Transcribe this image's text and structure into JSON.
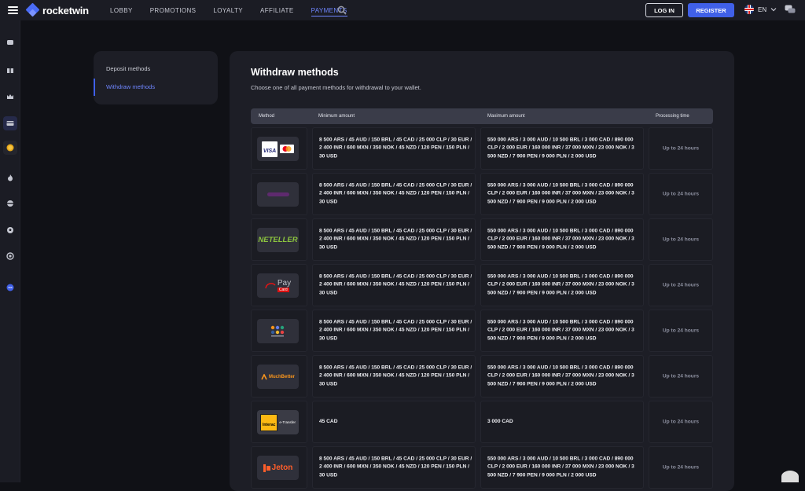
{
  "header": {
    "brand": "rocketwin",
    "nav": [
      {
        "label": "LOBBY",
        "active": false
      },
      {
        "label": "PROMOTIONS",
        "active": false
      },
      {
        "label": "LOYALTY",
        "active": false
      },
      {
        "label": "AFFILIATE",
        "active": false
      },
      {
        "label": "PAYMENTS",
        "active": true
      }
    ],
    "login_label": "LOG IN",
    "register_label": "REGISTER",
    "language": "EN"
  },
  "sidebar_icons": [
    "casino-icon",
    "gift-icon",
    "crown-icon",
    "card-icon",
    "coin-icon",
    "fire-icon",
    "tennis-icon",
    "soccer-icon",
    "settings-icon",
    "chat-icon"
  ],
  "side_menu": {
    "items": [
      {
        "label": "Deposit methods",
        "active": false
      },
      {
        "label": "Withdraw methods",
        "active": true
      }
    ]
  },
  "main": {
    "title": "Withdraw methods",
    "subtitle": "Choose one of all payment methods for withdrawal to your wallet.",
    "columns": [
      "Method",
      "Minimum amount",
      "Maximum amount",
      "Processing time"
    ],
    "rows": [
      {
        "method": "visa-mastercard",
        "logo_text": [
          "VISA"
        ],
        "min": "8 500 ARS / 45 AUD / 150 BRL / 45 CAD / 25 000 CLP / 30 EUR / 2 400 INR / 600 MXN / 350 NOK / 45 NZD / 120 PEN / 150 PLN / 30 USD",
        "max": "550 000 ARS / 3 000 AUD / 10 500 BRL / 3 000 CAD / 890 000 CLP / 2 000 EUR / 160 000 INR / 37 000 MXN / 23 000 NOK / 3 500 NZD / 7 900 PEN / 9 000 PLN / 2 000 USD",
        "time": "Up to 24 hours"
      },
      {
        "method": "skrill",
        "logo_text": [],
        "min": "8 500 ARS / 45 AUD / 150 BRL / 45 CAD / 25 000 CLP / 30 EUR / 2 400 INR / 600 MXN / 350 NOK / 45 NZD / 120 PEN / 150 PLN / 30 USD",
        "max": "550 000 ARS / 3 000 AUD / 10 500 BRL / 3 000 CAD / 890 000 CLP / 2 000 EUR / 160 000 INR / 37 000 MXN / 23 000 NOK / 3 500 NZD / 7 900 PEN / 9 000 PLN / 2 000 USD",
        "time": "Up to 24 hours"
      },
      {
        "method": "neteller",
        "logo_text": [
          "NETELLER"
        ],
        "min": "8 500 ARS / 45 AUD / 150 BRL / 45 CAD / 25 000 CLP / 30 EUR / 2 400 INR / 600 MXN / 350 NOK / 45 NZD / 120 PEN / 150 PLN / 30 USD",
        "max": "550 000 ARS / 3 000 AUD / 10 500 BRL / 3 000 CAD / 890 000 CLP / 2 000 EUR / 160 000 INR / 37 000 MXN / 23 000 NOK / 3 500 NZD / 7 900 PEN / 9 000 PLN / 2 000 USD",
        "time": "Up to 24 hours"
      },
      {
        "method": "paycard",
        "logo_text": [
          "Pay",
          "Card"
        ],
        "min": "8 500 ARS / 45 AUD / 150 BRL / 45 CAD / 25 000 CLP / 30 EUR / 2 400 INR / 600 MXN / 350 NOK / 45 NZD / 120 PEN / 150 PLN / 30 USD",
        "max": "550 000 ARS / 3 000 AUD / 10 500 BRL / 3 000 CAD / 890 000 CLP / 2 000 EUR / 160 000 INR / 37 000 MXN / 23 000 NOK / 3 500 NZD / 7 900 PEN / 9 000 PLN / 2 000 USD",
        "time": "Up to 24 hours"
      },
      {
        "method": "cryptocurrency",
        "logo_text": [],
        "min": "8 500 ARS / 45 AUD / 150 BRL / 45 CAD / 25 000 CLP / 30 EUR / 2 400 INR / 600 MXN / 350 NOK / 45 NZD / 120 PEN / 150 PLN / 30 USD",
        "max": "550 000 ARS / 3 000 AUD / 10 500 BRL / 3 000 CAD / 890 000 CLP / 2 000 EUR / 160 000 INR / 37 000 MXN / 23 000 NOK / 3 500 NZD / 7 900 PEN / 9 000 PLN / 2 000 USD",
        "time": "Up to 24 hours"
      },
      {
        "method": "muchbetter",
        "logo_text": [
          "MuchBetter"
        ],
        "min": "8 500 ARS / 45 AUD / 150 BRL / 45 CAD / 25 000 CLP / 30 EUR / 2 400 INR / 600 MXN / 350 NOK / 45 NZD / 120 PEN / 150 PLN / 30 USD",
        "max": "550 000 ARS / 3 000 AUD / 10 500 BRL / 3 000 CAD / 890 000 CLP / 2 000 EUR / 160 000 INR / 37 000 MXN / 23 000 NOK / 3 500 NZD / 7 900 PEN / 9 000 PLN / 2 000 USD",
        "time": "Up to 24 hours"
      },
      {
        "method": "interac",
        "logo_text": [
          "Interac",
          "e-Transfer"
        ],
        "min": "45 CAD",
        "max": "3 000 CAD",
        "time": "Up to 24 hours"
      },
      {
        "method": "jeton",
        "logo_text": [
          "Jeton"
        ],
        "min": "8 500 ARS / 45 AUD / 150 BRL / 45 CAD / 25 000 CLP / 30 EUR / 2 400 INR / 600 MXN / 350 NOK / 45 NZD / 120 PEN / 150 PLN / 30 USD",
        "max": "550 000 ARS / 3 000 AUD / 10 500 BRL / 3 000 CAD / 890 000 CLP / 2 000 EUR / 160 000 INR / 37 000 MXN / 23 000 NOK / 3 500 NZD / 7 900 PEN / 9 000 PLN / 2 000 USD",
        "time": "Up to 24 hours"
      }
    ]
  },
  "colors": {
    "accent": "#4060e8",
    "active_link": "#6f86ff",
    "panel": "#1d1e26",
    "background": "#101116",
    "muted": "#8d90a0"
  }
}
